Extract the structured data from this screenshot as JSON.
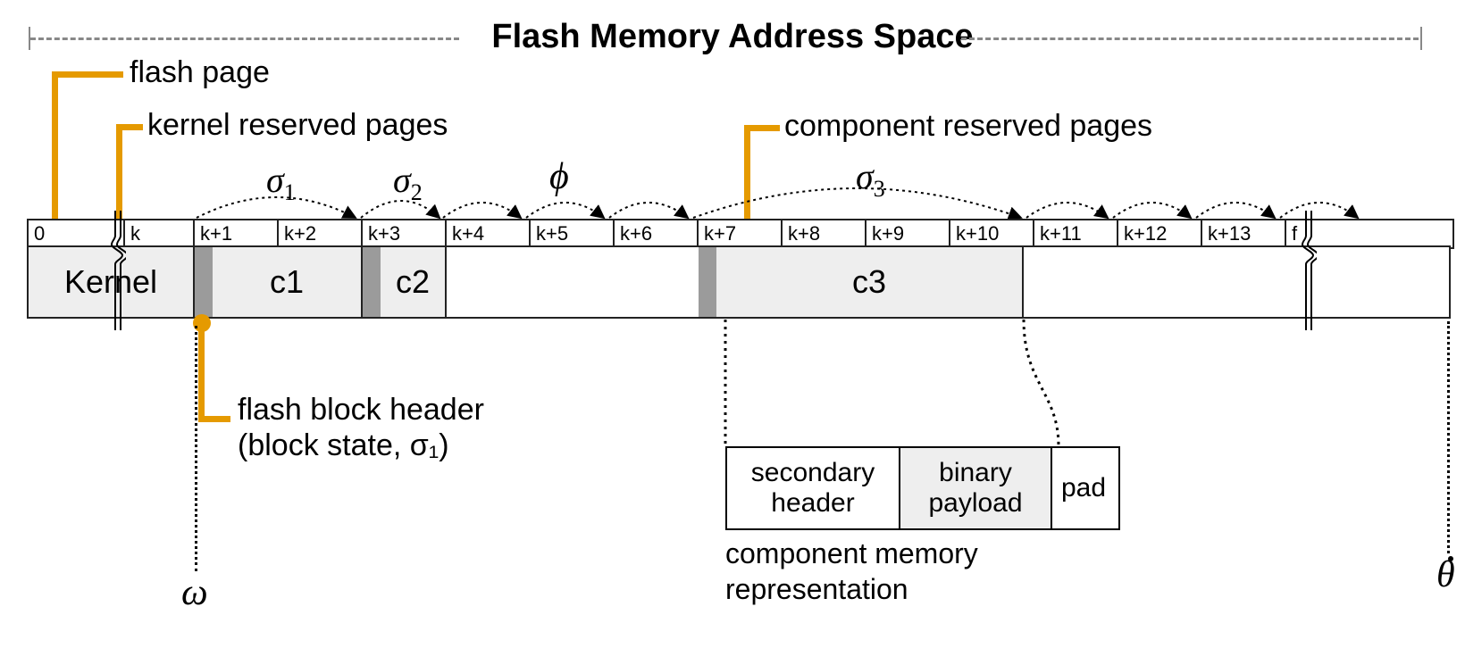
{
  "title": "Flash Memory Address Space",
  "callouts": {
    "flash_page": "flash page",
    "kernel_reserved": "kernel reserved pages",
    "component_reserved": "component reserved pages",
    "flash_block_header_l1": "flash block header",
    "flash_block_header_l2": "(block state, σ₁)"
  },
  "indices": {
    "zero": "0",
    "k": "k",
    "k1": "k+1",
    "k2": "k+2",
    "k3": "k+3",
    "k4": "k+4",
    "k5": "k+5",
    "k6": "k+6",
    "k7": "k+7",
    "k8": "k+8",
    "k9": "k+9",
    "k10": "k+10",
    "k11": "k+11",
    "k12": "k+12",
    "k13": "k+13",
    "f": "f"
  },
  "blocks": {
    "kernel": "Kernel",
    "c1": "c1",
    "c2": "c2",
    "c3": "c3"
  },
  "greek": {
    "s1_base": "σ",
    "s1_sub": "1",
    "s2_base": "σ",
    "s2_sub": "2",
    "phi": "ϕ",
    "s3_base": "σ",
    "s3_sub": "3",
    "omega": "ω",
    "theta": "θ"
  },
  "cmr": {
    "secondary_l1": "secondary",
    "secondary_l2": "header",
    "binary_l1": "binary",
    "binary_l2": "payload",
    "pad": "pad",
    "caption_l1": "component memory",
    "caption_l2": "representation"
  }
}
